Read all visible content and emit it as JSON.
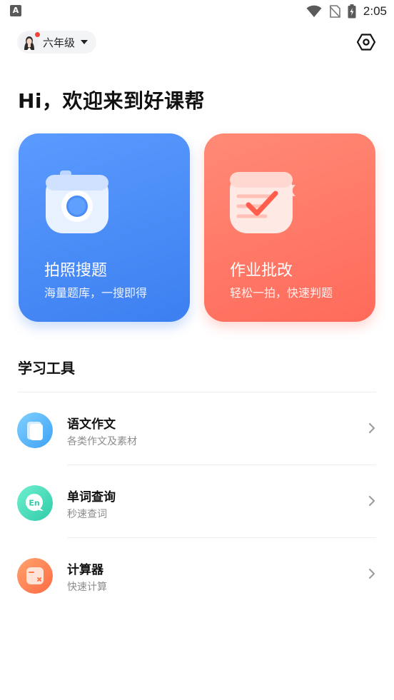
{
  "status_bar": {
    "left_icon": "A",
    "time": "2:05"
  },
  "header": {
    "grade": "六年级"
  },
  "greeting": "Hi，欢迎来到好课帮",
  "features": [
    {
      "title": "拍照搜题",
      "subtitle": "海量题库，一搜即得",
      "color": "#4a8cf7"
    },
    {
      "title": "作业批改",
      "subtitle": "轻松一拍，快速判题",
      "color": "#ff7463"
    }
  ],
  "tools_section": {
    "title": "学习工具",
    "items": [
      {
        "name": "语文作文",
        "desc": "各类作文及素材",
        "icon": "book-icon"
      },
      {
        "name": "单词查询",
        "desc": "秒速查词",
        "icon": "english-chat-icon"
      },
      {
        "name": "计算器",
        "desc": "快速计算",
        "icon": "calculator-icon"
      }
    ]
  }
}
